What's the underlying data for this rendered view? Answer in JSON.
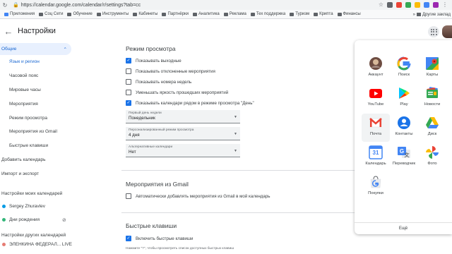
{
  "browser": {
    "url": "https://calendar.google.com/calendar/r/settings?tab=cc",
    "bookmarks": [
      "Приложения",
      "Соц Сети",
      "Обучение",
      "Инструменты",
      "Кабинеты",
      "Партнёрки",
      "Аналитика",
      "Реклама",
      "Тех поддержка",
      "Туризм",
      "Крипта",
      "Финансы"
    ],
    "other_bookmarks": "Другие заклад"
  },
  "header": {
    "back_icon": "arrow-left-icon",
    "title": "Настройки"
  },
  "sidebar": {
    "general": "Общие",
    "general_items": [
      "Язык и регион",
      "Часовой пояс",
      "Мировые часы",
      "Мероприятия",
      "Режим просмотра",
      "Мероприятия из Gmail",
      "Быстрые клавиши"
    ],
    "top_items": [
      "Добавить календарь",
      "Импорт и экспорт"
    ],
    "my_calendars_head": "Настройки моих календарей",
    "my_calendars": [
      {
        "name": "Sergey Zhuravlev",
        "color": "#039be5"
      },
      {
        "name": "Дни рождения",
        "color": "#33b679"
      }
    ],
    "other_calendars_head": "Настройки других календарей",
    "other_calendar_truncated": "ЭЛЕНКИНА ФЕДЕРАЛ... LIVE"
  },
  "view": {
    "title": "Режим просмотра",
    "options": [
      {
        "label": "Показывать выходные",
        "checked": true
      },
      {
        "label": "Показывать отклоненные мероприятия",
        "checked": false
      },
      {
        "label": "Показывать номера недель",
        "checked": false
      },
      {
        "label": "Уменьшать яркость прошедших мероприятий",
        "checked": false
      },
      {
        "label": "Показывать календари рядом в режиме просмотра \"День\"",
        "checked": true
      }
    ],
    "selects": [
      {
        "label": "Первый день недели",
        "value": "Понедельник"
      },
      {
        "label": "Персонализированный режим просмотра",
        "value": "4 дня"
      },
      {
        "label": "Альтернативные календари",
        "value": "Нет"
      }
    ]
  },
  "gmail": {
    "title": "Мероприятия из Gmail",
    "option": {
      "label": "Автоматически добавлять мероприятия из Gmail в мой календарь",
      "checked": false
    }
  },
  "shortcuts": {
    "title": "Быстрые клавиши",
    "option": {
      "label": "Включить быстрые клавиши",
      "checked": true
    },
    "note": "Нажмите \"?\", чтобы просмотреть список доступных быстрых клавиш"
  },
  "apps_panel": {
    "apps": [
      {
        "name": "Аккаунт",
        "icon": "account-icon"
      },
      {
        "name": "Поиск",
        "icon": "google-search-icon"
      },
      {
        "name": "Карты",
        "icon": "maps-icon"
      },
      {
        "name": "YouTube",
        "icon": "youtube-icon"
      },
      {
        "name": "Play",
        "icon": "play-store-icon"
      },
      {
        "name": "Новости",
        "icon": "news-icon"
      },
      {
        "name": "Почта",
        "icon": "gmail-icon"
      },
      {
        "name": "Контакты",
        "icon": "contacts-icon"
      },
      {
        "name": "Диск",
        "icon": "drive-icon"
      },
      {
        "name": "Календарь",
        "icon": "calendar-icon"
      },
      {
        "name": "Переводчик",
        "icon": "translate-icon"
      },
      {
        "name": "Фото",
        "icon": "photos-icon"
      },
      {
        "name": "Покупки",
        "icon": "shopping-icon"
      }
    ],
    "calendar_day": "31",
    "more": "Ещё"
  },
  "colors": {
    "accent": "#1a73e8",
    "active_bg": "#e8f0fe"
  }
}
